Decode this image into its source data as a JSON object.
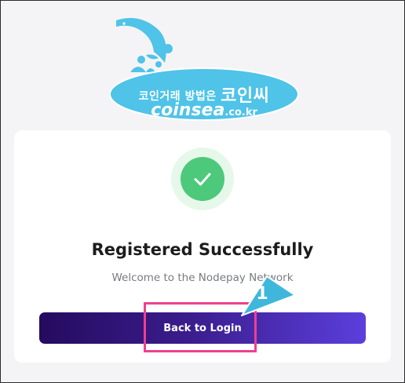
{
  "logo": {
    "korean_tagline": "코인거래 방법은",
    "korean_brand": "코인씨",
    "brand_domain": "coinsea",
    "brand_tld": ".co.kr",
    "accent_color": "#4fc3e8"
  },
  "status": {
    "icon": "check-icon",
    "color": "#4cc97b"
  },
  "main": {
    "title": "Registered Successfully",
    "subtitle": "Welcome to the Nodepay Network",
    "button_label": "Back to Login"
  },
  "annotation": {
    "step_number": "1",
    "color": "#ef3f8f"
  }
}
